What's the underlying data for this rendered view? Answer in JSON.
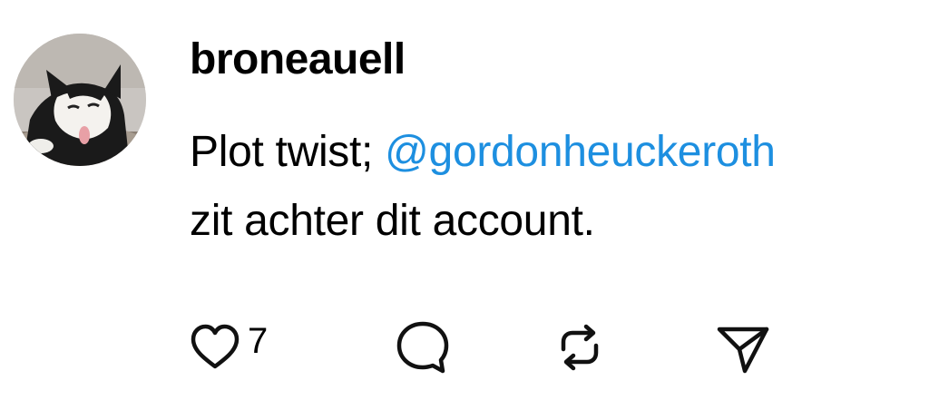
{
  "post": {
    "username": "broneauell",
    "text_before": "Plot twist; ",
    "mention": "@gordonheuckeroth",
    "text_line2": "zit achter dit account.",
    "like_count": "7"
  },
  "icons": {
    "like": "heart-icon",
    "comment": "speech-bubble-icon",
    "repost": "repost-icon",
    "share": "paper-plane-icon"
  },
  "colors": {
    "mention": "#1d8fe0",
    "text": "#000000",
    "icon": "#111111"
  }
}
